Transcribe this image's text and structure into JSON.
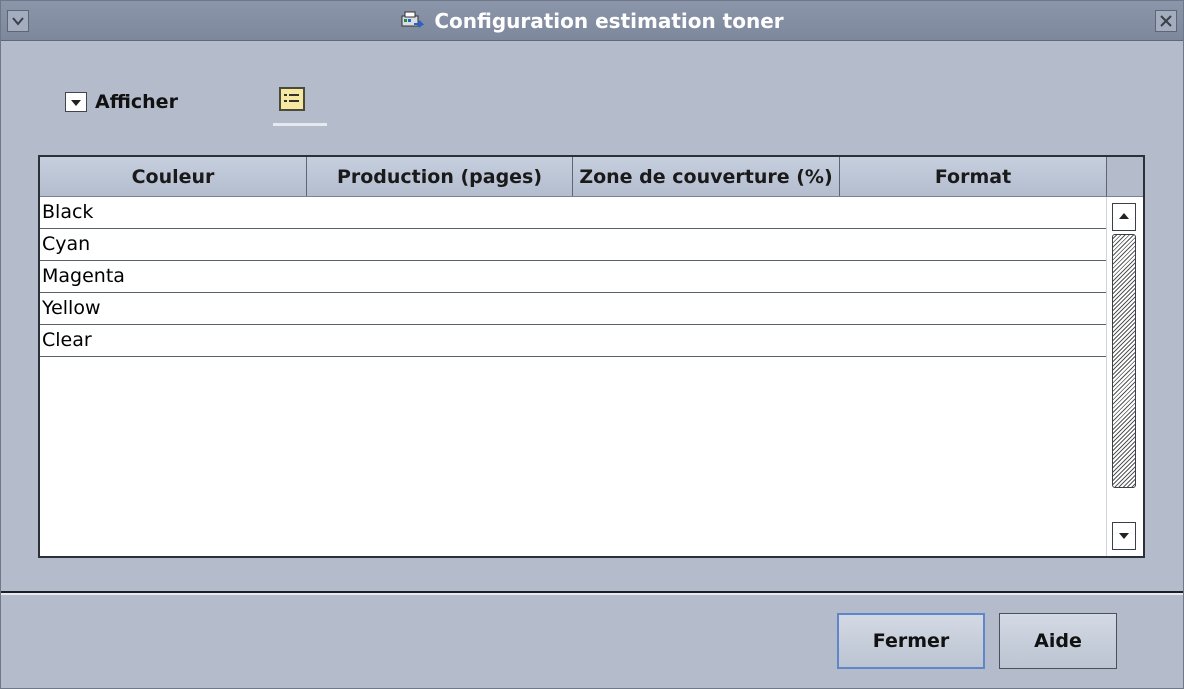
{
  "window": {
    "title": "Configuration estimation toner"
  },
  "toolbar": {
    "afficher_label": "Afficher"
  },
  "table": {
    "headers": [
      "Couleur",
      "Production (pages)",
      "Zone de couverture (%)",
      "Format"
    ],
    "rows": [
      "Black",
      "Cyan",
      "Magenta",
      "Yellow",
      "Clear"
    ]
  },
  "footer": {
    "fermer_label": "Fermer",
    "aide_label": "Aide"
  }
}
